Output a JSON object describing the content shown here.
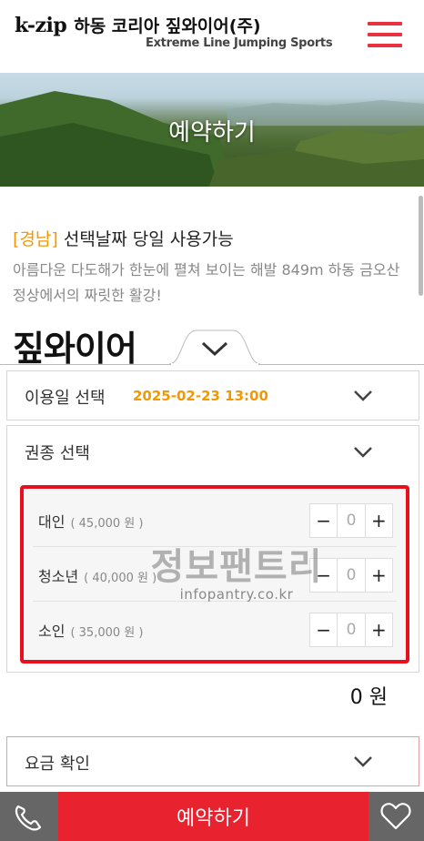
{
  "header": {
    "brand": "k-zip",
    "title": "하동 코리아 짚와이어(주)",
    "subtitle": "Extreme Line Jumping Sports"
  },
  "banner": {
    "title": "예약하기"
  },
  "intro": {
    "tag": "[경남]",
    "headline": " 선택날짜 당일 사용가능",
    "description": "아름다운 다도해가 한눈에 펼쳐 보이는 해발 849m 하동 금오산 정상에서의 짜릿한 활강!"
  },
  "section": {
    "title": "짚와이어"
  },
  "date_row": {
    "label": "이용일 선택",
    "value": "2025-02-23 13:00"
  },
  "ticket_row": {
    "label": "권종 선택"
  },
  "tickets": [
    {
      "name": "대인",
      "price": "( 45,000 원 )",
      "qty": "0"
    },
    {
      "name": "청소년",
      "price": "( 40,000 원 )",
      "qty": "0"
    },
    {
      "name": "소인",
      "price": "( 35,000 원 )",
      "qty": "0"
    }
  ],
  "stepper": {
    "minus": "−",
    "plus": "+"
  },
  "total": "0 원",
  "fee_row": {
    "label": "요금 확인"
  },
  "watermark": {
    "main": "정보팬트리",
    "sub": "infopantry.co.kr"
  },
  "bottom_bar": {
    "reserve_label": "예약하기"
  },
  "colors": {
    "accent": "#e8232f",
    "highlight": "#f39800",
    "box_border": "#e8101c"
  }
}
